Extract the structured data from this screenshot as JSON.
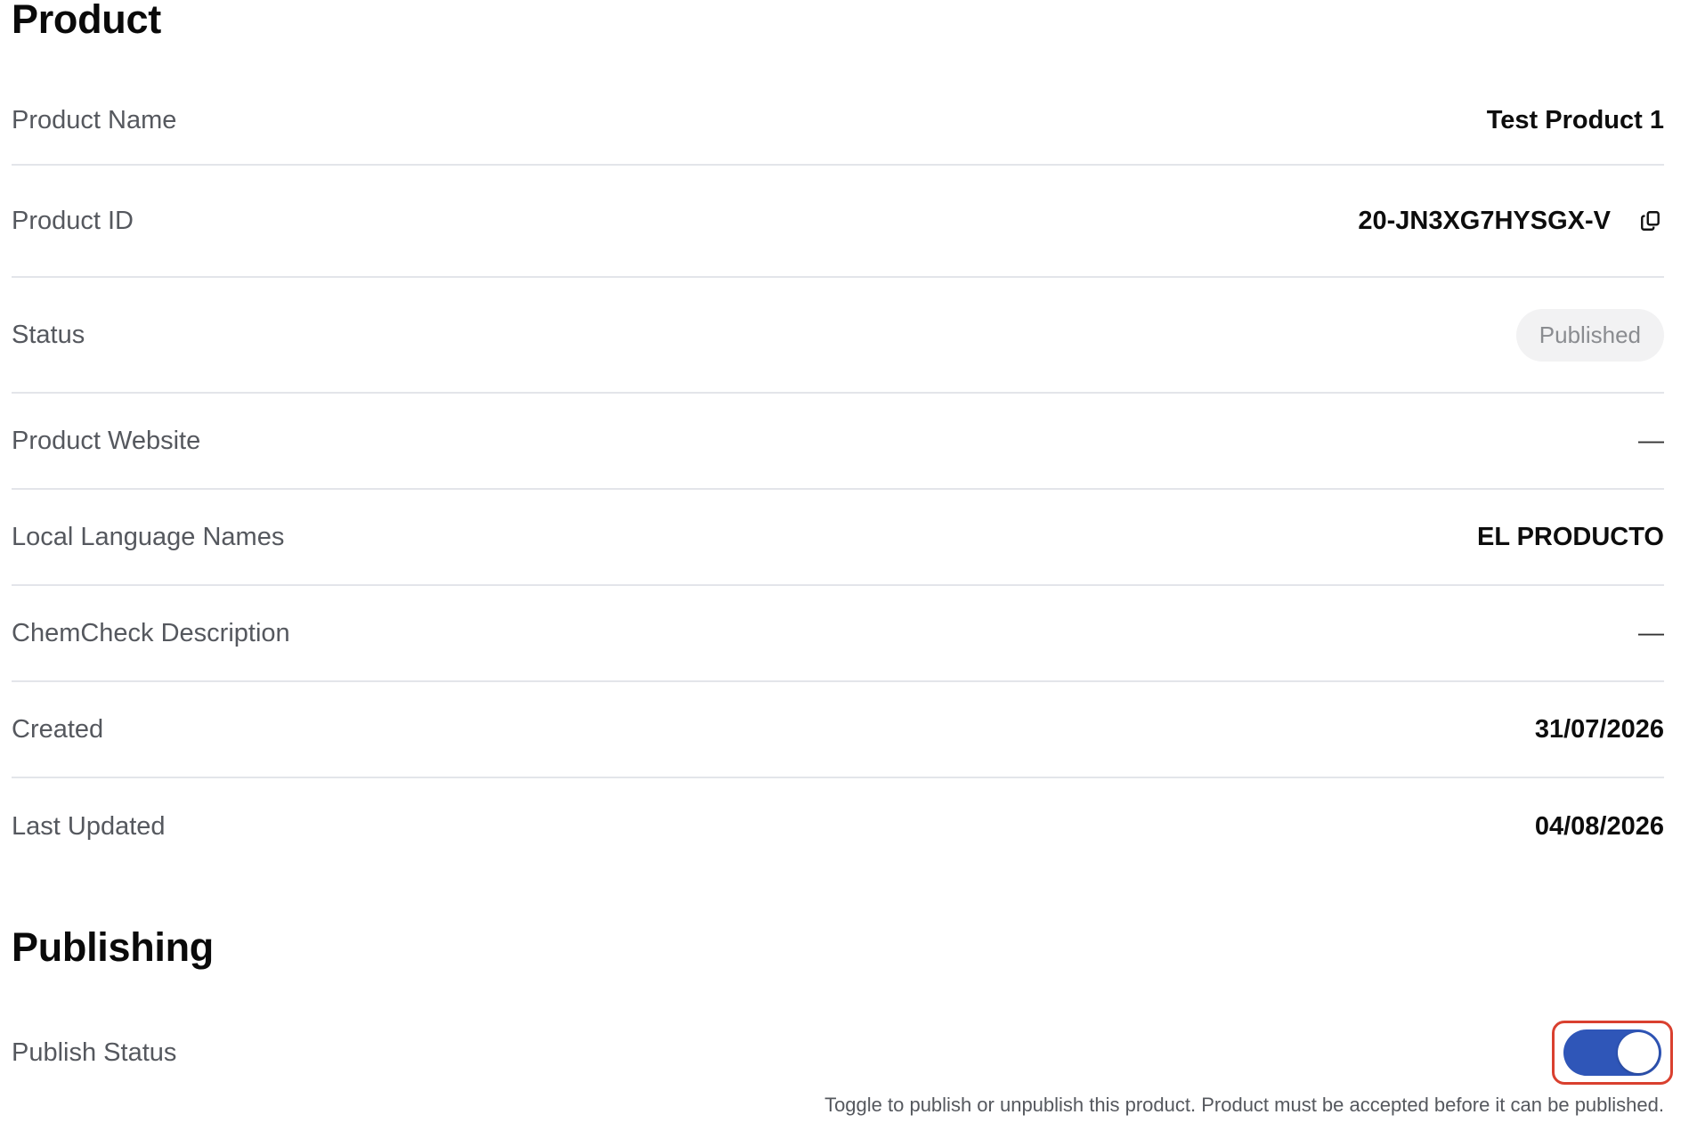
{
  "product": {
    "title": "Product",
    "rows": {
      "name": {
        "label": "Product Name",
        "value": "Test Product 1"
      },
      "id": {
        "label": "Product ID",
        "value": "20-JN3XG7HYSGX-V"
      },
      "status": {
        "label": "Status",
        "value": "Published"
      },
      "website": {
        "label": "Product Website",
        "value": "—"
      },
      "local_names": {
        "label": "Local Language Names",
        "value": "EL PRODUCTO"
      },
      "chemcheck": {
        "label": "ChemCheck Description",
        "value": "—"
      },
      "created": {
        "label": "Created",
        "value": "31/07/2026"
      },
      "updated": {
        "label": "Last Updated",
        "value": "04/08/2026"
      }
    }
  },
  "publishing": {
    "title": "Publishing",
    "publish_status_label": "Publish Status",
    "toggle_on": true,
    "help_text": "Toggle to publish or unpublish this product. Product must be accepted before it can be published."
  },
  "colors": {
    "toggle_on": "#2f56b8",
    "highlight_border": "#d9402f",
    "divider": "#e3e5ea"
  },
  "icons": {
    "copy": "copy-icon"
  }
}
